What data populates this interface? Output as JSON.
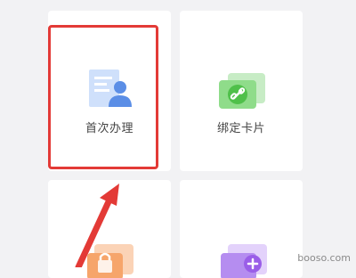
{
  "tiles": [
    {
      "label": "首次办理",
      "icon": "id-card-person-icon"
    },
    {
      "label": "绑定卡片",
      "icon": "card-link-icon"
    },
    {
      "label": "",
      "icon": "lock-card-icon"
    },
    {
      "label": "",
      "icon": "add-card-icon"
    }
  ],
  "annotation": {
    "highlight_color": "#e33a36",
    "arrow_color": "#e33a36"
  },
  "watermark": "booso.com"
}
